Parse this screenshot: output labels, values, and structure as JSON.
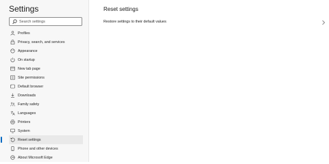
{
  "sidebar": {
    "title": "Settings",
    "search": {
      "placeholder": "Search settings"
    },
    "items": [
      {
        "label": "Profiles",
        "icon": "profile-icon"
      },
      {
        "label": "Privacy, search, and services",
        "icon": "lock-icon"
      },
      {
        "label": "Appearance",
        "icon": "appearance-icon"
      },
      {
        "label": "On startup",
        "icon": "power-icon"
      },
      {
        "label": "New tab page",
        "icon": "new-tab-icon"
      },
      {
        "label": "Site permissions",
        "icon": "site-permissions-icon"
      },
      {
        "label": "Default browser",
        "icon": "browser-icon"
      },
      {
        "label": "Downloads",
        "icon": "download-icon"
      },
      {
        "label": "Family safety",
        "icon": "family-icon"
      },
      {
        "label": "Languages",
        "icon": "language-icon"
      },
      {
        "label": "Printers",
        "icon": "printer-icon"
      },
      {
        "label": "System",
        "icon": "system-icon"
      },
      {
        "label": "Reset settings",
        "icon": "reset-icon",
        "active": true
      },
      {
        "label": "Phone and other devices",
        "icon": "phone-icon"
      },
      {
        "label": "About Microsoft Edge",
        "icon": "edge-icon"
      }
    ]
  },
  "main": {
    "title": "Reset settings",
    "options": [
      {
        "label": "Restore settings to their default values",
        "icon": "chevron-right-icon"
      }
    ]
  },
  "colors": {
    "accent": "#0067c0",
    "sidebar_bg": "#f7f7f7",
    "active_bg": "#e9e9e9"
  }
}
